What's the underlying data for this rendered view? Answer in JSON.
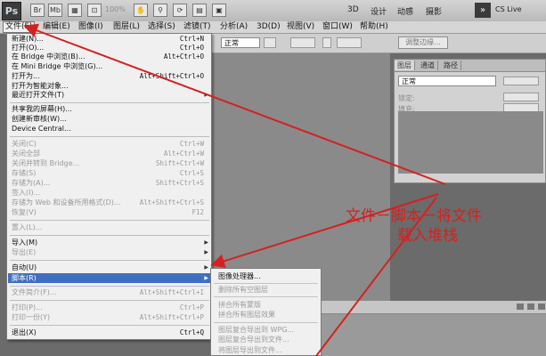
{
  "toolbar": {
    "logo": "Ps",
    "icon1": "Br",
    "icon2": "Mb",
    "zoom": "100%",
    "workspaces": [
      "3D",
      "设计",
      "动感",
      "摄影"
    ],
    "more": "»",
    "cs_live": "CS Live"
  },
  "menubar": {
    "items": [
      "文件(F)",
      "编辑(E)",
      "图像(I)",
      "图层(L)",
      "选择(S)",
      "滤镜(T)",
      "分析(A)",
      "3D(D)",
      "视图(V)",
      "窗口(W)",
      "帮助(H)"
    ]
  },
  "options": {
    "mode": "正常",
    "refine_button": "调整边缘..."
  },
  "panels": {
    "tabs": [
      "图层",
      "通道",
      "路径"
    ],
    "blend_mode": "正常",
    "row2": "锁定:",
    "row3": "填充:"
  },
  "file_menu": {
    "items": [
      {
        "label": "新建(N)...",
        "shortcut": "Ctrl+N",
        "disabled": false
      },
      {
        "label": "打开(O)...",
        "shortcut": "Ctrl+O",
        "disabled": false
      },
      {
        "label": "在 Bridge 中浏览(B)...",
        "shortcut": "Alt+Ctrl+O",
        "disabled": false
      },
      {
        "label": "在 Mini Bridge 中浏览(G)...",
        "shortcut": "",
        "disabled": false
      },
      {
        "label": "打开为...",
        "shortcut": "Alt+Shift+Ctrl+O",
        "disabled": false
      },
      {
        "label": "打开为智能对象...",
        "shortcut": "",
        "disabled": false
      },
      {
        "label": "最近打开文件(T)",
        "shortcut": "",
        "disabled": false
      },
      {
        "label": "共享我的屏幕(H)...",
        "shortcut": "",
        "disabled": false
      },
      {
        "label": "创建新审核(W)...",
        "shortcut": "",
        "disabled": false
      },
      {
        "label": "Device Central...",
        "shortcut": "",
        "disabled": false
      },
      {
        "label": "关闭(C)",
        "shortcut": "Ctrl+W",
        "disabled": true
      },
      {
        "label": "关闭全部",
        "shortcut": "Alt+Ctrl+W",
        "disabled": true
      },
      {
        "label": "关闭并转到 Bridge...",
        "shortcut": "Shift+Ctrl+W",
        "disabled": true
      },
      {
        "label": "存储(S)",
        "shortcut": "Ctrl+S",
        "disabled": true
      },
      {
        "label": "存储为(A)...",
        "shortcut": "Shift+Ctrl+S",
        "disabled": true
      },
      {
        "label": "签入(I)...",
        "shortcut": "",
        "disabled": true
      },
      {
        "label": "存储为 Web 和设备所用格式(D)...",
        "shortcut": "Alt+Shift+Ctrl+S",
        "disabled": true
      },
      {
        "label": "恢复(V)",
        "shortcut": "F12",
        "disabled": true
      },
      {
        "label": "置入(L)...",
        "shortcut": "",
        "disabled": true
      },
      {
        "label": "导入(M)",
        "shortcut": "",
        "disabled": false
      },
      {
        "label": "导出(E)",
        "shortcut": "",
        "disabled": true
      },
      {
        "label": "自动(U)",
        "shortcut": "",
        "disabled": false
      },
      {
        "label": "脚本(R)",
        "shortcut": "",
        "disabled": false
      },
      {
        "label": "文件简介(F)...",
        "shortcut": "Alt+Shift+Ctrl+I",
        "disabled": true
      },
      {
        "label": "打印(P)...",
        "shortcut": "Ctrl+P",
        "disabled": true
      },
      {
        "label": "打印一份(Y)",
        "shortcut": "Alt+Shift+Ctrl+P",
        "disabled": true
      },
      {
        "label": "退出(X)",
        "shortcut": "Ctrl+Q",
        "disabled": false
      }
    ]
  },
  "script_submenu": {
    "items": [
      {
        "label": "图像处理器...",
        "disabled": false
      },
      {
        "label": "删除所有空图层",
        "disabled": true
      },
      {
        "label": "拼合所有蒙版",
        "disabled": true
      },
      {
        "label": "拼合所有图层效果",
        "disabled": true
      },
      {
        "label": "图层复合导出到 WPG...",
        "disabled": true
      },
      {
        "label": "图层复合导出到文件...",
        "disabled": true
      },
      {
        "label": "将图层导出到文件...",
        "disabled": true
      }
    ]
  },
  "annotation": {
    "line1": "文件－脚本－将文件",
    "line2": "载入堆栈",
    "color": "#d62020"
  }
}
